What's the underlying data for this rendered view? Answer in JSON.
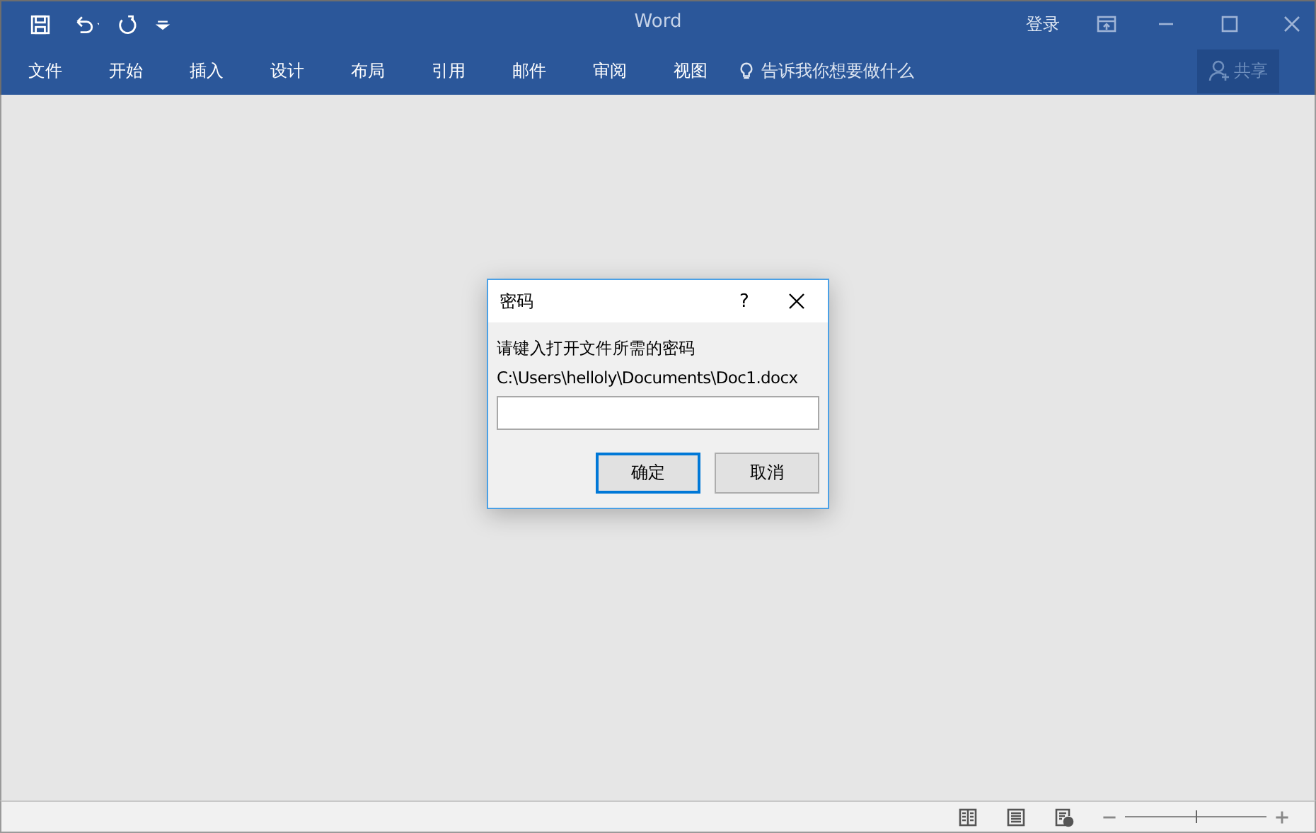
{
  "window": {
    "title": "Word",
    "sign_in": "登录"
  },
  "ribbon": {
    "tabs": [
      "文件",
      "开始",
      "插入",
      "设计",
      "布局",
      "引用",
      "邮件",
      "审阅",
      "视图"
    ],
    "tell_me": "告诉我你想要做什么",
    "share": "共享"
  },
  "dialog": {
    "title": "密码",
    "help": "?",
    "prompt": "请键入打开文件所需的密码",
    "path": "C:\\Users\\helloly\\Documents\\Doc1.docx",
    "buttons": [
      {
        "label": "确定",
        "selected": true
      },
      {
        "label": "取消",
        "selected": false
      }
    ]
  },
  "status_bar": {
    "zoom": {
      "level": 0.5
    }
  }
}
